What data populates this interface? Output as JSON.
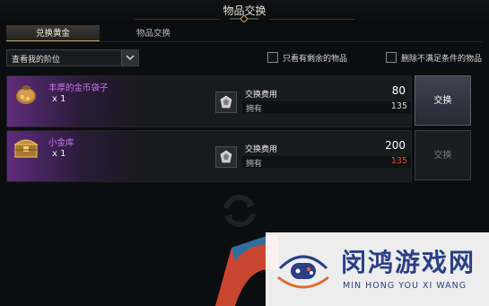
{
  "window": {
    "title": "物品交换"
  },
  "tabs": [
    {
      "label": "兑换黄金",
      "active": true
    },
    {
      "label": "物品交换",
      "active": false
    }
  ],
  "filter": {
    "selected": "查看我的阶位"
  },
  "checkboxes": [
    {
      "label": "只看有剩余的物品",
      "checked": false
    },
    {
      "label": "删除不满足条件的物品",
      "checked": false
    }
  ],
  "items": [
    {
      "name": "丰厚的金币袋子",
      "quantity": "x 1",
      "cost_label": "交换费用",
      "cost": "80",
      "own_label": "拥有",
      "owned": "135",
      "button": "交换",
      "enabled": true,
      "icon": "gold-pouch-icon"
    },
    {
      "name": "小金库",
      "quantity": "x 1",
      "cost_label": "交换费用",
      "cost": "200",
      "own_label": "拥有",
      "owned": "135",
      "button": "交换",
      "enabled": false,
      "icon": "treasure-chest-icon"
    }
  ],
  "watermark": {
    "title": "闵鸿游戏网",
    "subtitle": "MIN HONG YOU XI WANG"
  },
  "colors": {
    "accent_gold": "#c3a866",
    "item_purple": "#cf78f2",
    "insufficient_red": "#ff3b3b",
    "watermark_blue": "#2b3f86"
  }
}
